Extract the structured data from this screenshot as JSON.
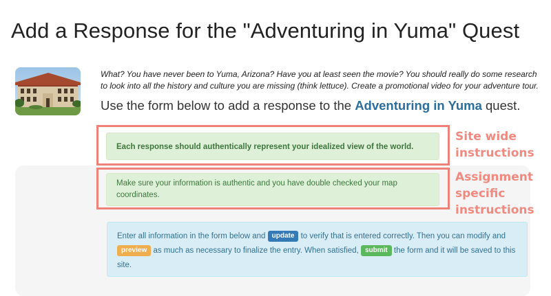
{
  "page": {
    "title": "Add a Response for the \"Adventuring in Yuma\" Quest"
  },
  "quest": {
    "description": "What? You have never been to Yuma, Arizona? Have you at least seen the movie? You should really do some research to look into all the history and culture you are missing (think lettuce). Create a promotional video for your adventure tour.",
    "lead_prefix": "Use the form below to add a response to the ",
    "lead_link": "Adventuring in Yuma",
    "lead_suffix": " quest."
  },
  "instructions": {
    "site_wide": "Each response should authentically represent your idealized view of the world.",
    "assignment": "Make sure your information is authentic and you have double checked your map coordinates."
  },
  "callouts": {
    "site_line1": "Site wide",
    "site_line2": "instructions",
    "assign_line1": "Assignment",
    "assign_line2": "specific",
    "assign_line3": "instructions"
  },
  "info": {
    "part1": "Enter all information in the form below and ",
    "update_label": "update",
    "part2": " to verify that is entered correctly. Then you can modify and ",
    "preview_label": "preview",
    "part3": " as much as necessary to finalize the entry. When satisfied, ",
    "submit_label": "submit",
    "part4": " the form and it will be saved to this site."
  },
  "colors": {
    "annotation": "#ef8278",
    "success_bg": "#dff0d8",
    "info_bg": "#d9edf7",
    "link": "#2a6e9c"
  }
}
